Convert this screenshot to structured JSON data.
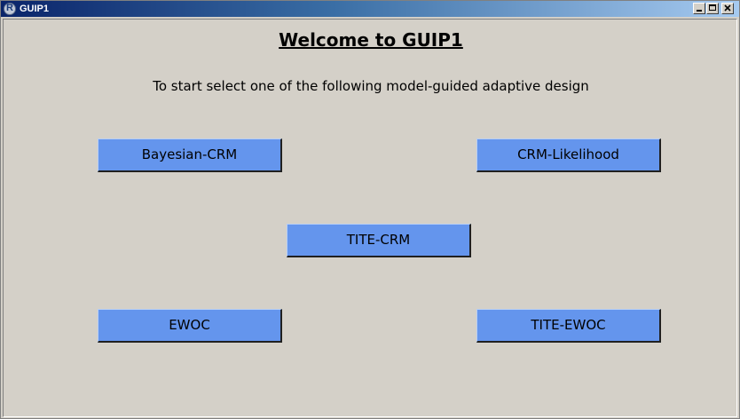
{
  "window": {
    "title": "GUIP1",
    "icon": "r-logo-icon",
    "controls": [
      "minimize-icon",
      "maximize-icon",
      "close-icon"
    ]
  },
  "main": {
    "heading": "Welcome to GUIP1",
    "instruction": "To start select one of the following model-guided adaptive design",
    "buttons": {
      "bayesian_crm": "Bayesian-CRM",
      "crm_likelihood": "CRM-Likelihood",
      "tite_crm": "TITE-CRM",
      "ewoc": "EWOC",
      "tite_ewoc": "TITE-EWOC"
    }
  },
  "colors": {
    "window_background": "#d4d0c8",
    "button_background": "#6495ed",
    "titlebar_start": "#0a246a",
    "titlebar_end": "#a6caf0"
  }
}
